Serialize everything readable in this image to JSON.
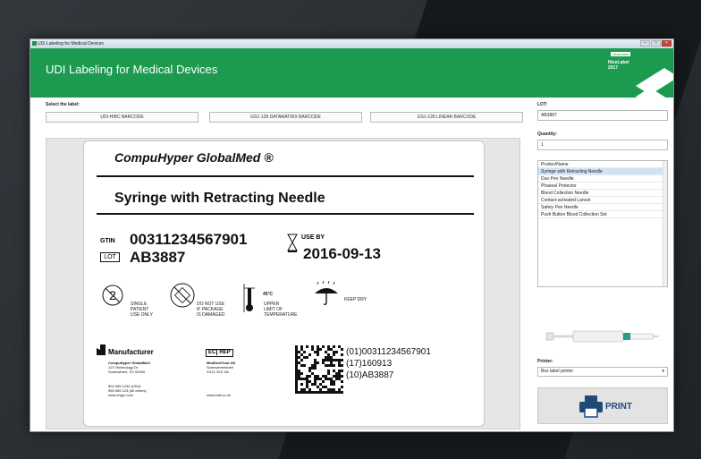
{
  "window": {
    "title": "UDI Labeling for Medical Devices"
  },
  "header": {
    "title": "UDI Labeling for Medical Devices",
    "logo_badge": "NiceLabel",
    "logo_text": "NiceLabel 2017"
  },
  "selector": {
    "label": "Select the label:",
    "options": [
      "UDI-HIBC BARCODE",
      "GS1-128 DATAMATRIX BARCODE",
      "GS1-128 LINEAR BARCODE"
    ]
  },
  "lot": {
    "label": "LOT:",
    "value": "AB3887"
  },
  "quantity": {
    "label": "Quantity:",
    "value": "1"
  },
  "product_list": {
    "header": "ProductName",
    "items": [
      "Syringe with Retracting Needle",
      "Duo Pen Needle",
      "Phaseal Protector",
      "Blood Collection Needle",
      "Contact-activated Lancet",
      "Safety Pen Needle",
      "Push Button Blood Collection Set"
    ],
    "selected_index": 0
  },
  "printer": {
    "label": "Printer:",
    "value": "Box label printer"
  },
  "print_button": {
    "label": "PRINT"
  },
  "preview": {
    "brand": "CompuHyper GlobalMed ®",
    "product": "Syringe with Retracting Needle",
    "gtin_label": "GTIN",
    "gtin": "00311234567901",
    "lot_label": "LOT",
    "lot": "AB3887",
    "useby_label": "USE BY",
    "useby": "2016-09-13",
    "symbols": {
      "single_use": [
        "SINGLE",
        "PATIENT",
        "USE ONLY"
      ],
      "damaged": [
        "DO NOT USE",
        "IF PACKAGE",
        "IS DAMAGED"
      ],
      "temp_value": "45°C",
      "temp": [
        "UPPER",
        "LIMIT OF",
        "TEMPERATURE"
      ],
      "dry": "KEEP DRY"
    },
    "manufacturer": {
      "title": "Manufacturer",
      "name": "CompuHyper GlobalMed",
      "addr1": "123 Technology Dr",
      "addr2": "Somewhere, XX 00000",
      "phone1": "800 555 1234 (USA)",
      "phone2": "555 555 123 (All others)",
      "web": "www.chgm.com"
    },
    "ecrep": {
      "ec": "EC",
      "rep": "REP",
      "name": "MedDevFront UK",
      "addr1": "Somewhereshire",
      "addr2": "XX12 3XX UK",
      "web": "www.mdf.co.uk"
    },
    "ai": [
      "(01)00311234567901",
      "(17)160913",
      "(10)AB3887"
    ]
  }
}
